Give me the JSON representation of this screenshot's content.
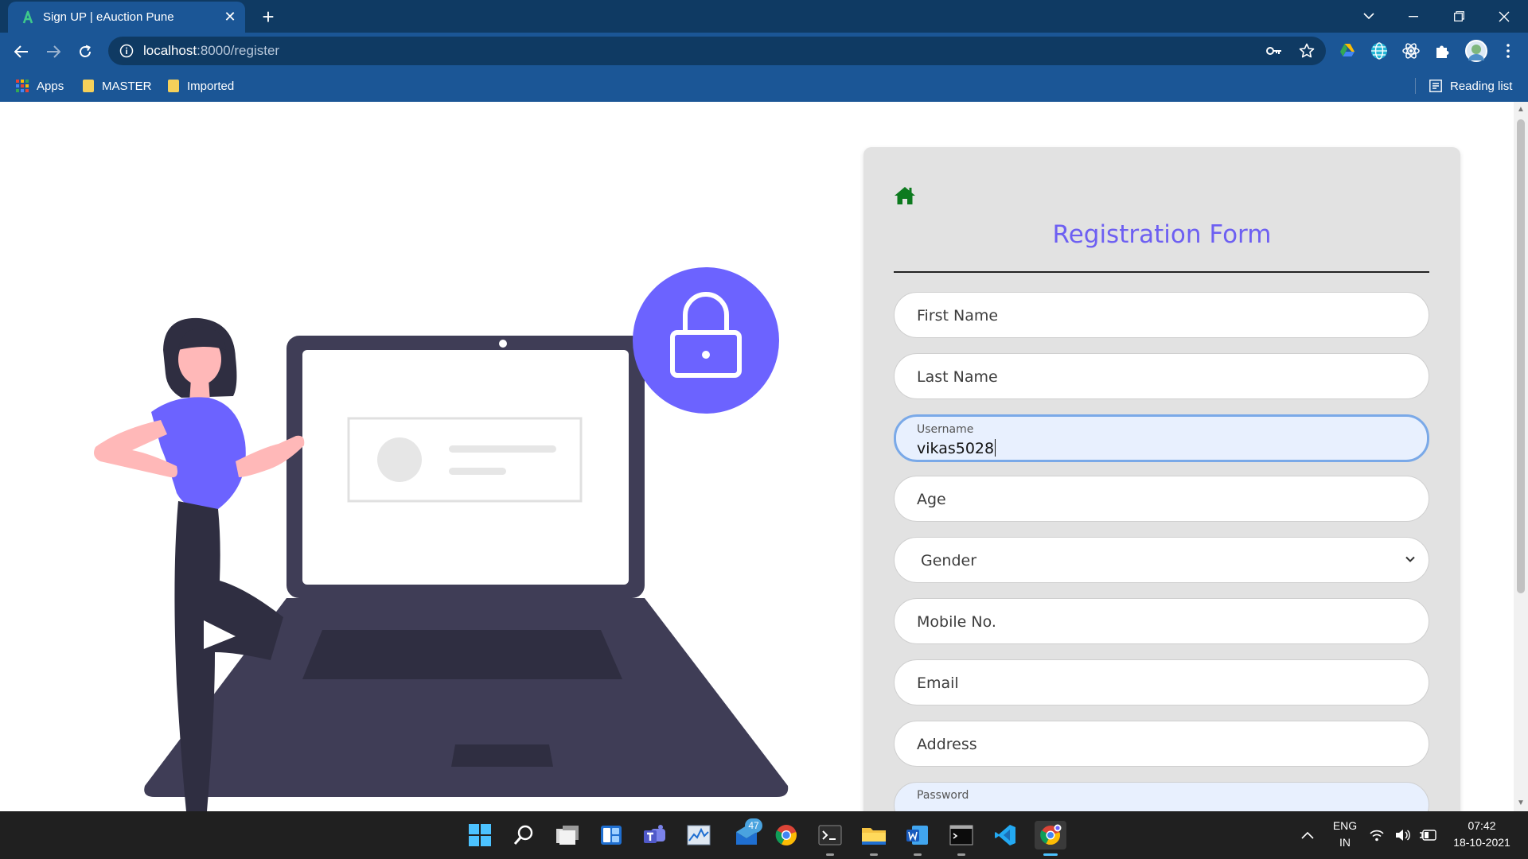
{
  "browser": {
    "tab_title": "Sign UP | eAuction Pune",
    "url_host": "localhost",
    "url_path": ":8000/register",
    "bookmarks": [
      "Apps",
      "MASTER",
      "Imported"
    ],
    "reading_list": "Reading list"
  },
  "form": {
    "title": "Registration Form",
    "fields": {
      "first_name": "First Name",
      "last_name": "Last Name",
      "username_label": "Username",
      "username_value": "vikas5028",
      "age": "Age",
      "gender": "Gender",
      "mobile": "Mobile No.",
      "email": "Email",
      "address": "Address",
      "password_label": "Password"
    }
  },
  "taskbar": {
    "badge_count": "47",
    "lang_top": "ENG",
    "lang_bottom": "IN",
    "time": "07:42",
    "date": "18-10-2021"
  },
  "colors": {
    "accent": "#6c63ff",
    "chrome_dark": "#0f3a63",
    "chrome": "#1b5696",
    "home_icon": "#0d7a1f"
  }
}
